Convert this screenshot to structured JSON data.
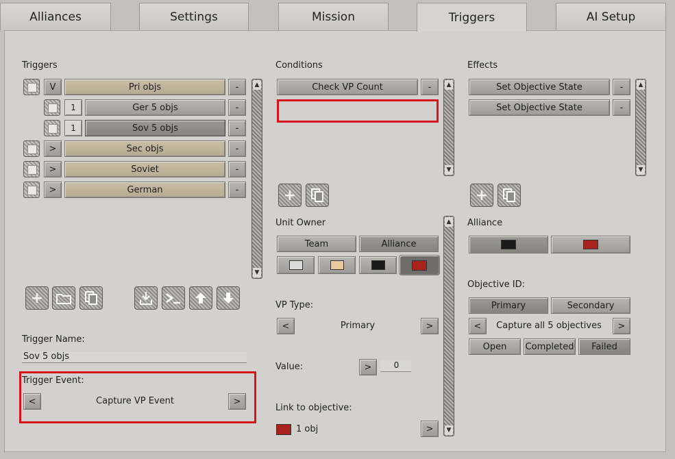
{
  "tabs": [
    "Alliances",
    "Settings",
    "Mission",
    "Triggers",
    "AI Setup"
  ],
  "triggers": {
    "heading": "Triggers",
    "rows": [
      {
        "expand": "V",
        "label": "Pri objs",
        "remove": "-"
      },
      {
        "expand": "1",
        "label": "Ger 5 objs",
        "remove": "-"
      },
      {
        "expand": "1",
        "label": "Sov 5 objs",
        "remove": "-"
      },
      {
        "expand": ">",
        "label": "Sec objs",
        "remove": "-"
      },
      {
        "expand": ">",
        "label": "Soviet",
        "remove": "-"
      },
      {
        "expand": ">",
        "label": "German",
        "remove": "-"
      }
    ],
    "name_label": "Trigger Name:",
    "name_value": "Sov 5 objs",
    "event_label": "Trigger Event:",
    "event_prev": "<",
    "event_value": "Capture VP Event",
    "event_next": ">"
  },
  "conditions": {
    "heading": "Conditions",
    "items": [
      {
        "label": "Check VP Count",
        "remove": "-"
      }
    ],
    "unit_owner_label": "Unit Owner",
    "team_label": "Team",
    "alliance_label": "Alliance",
    "owner_colors": [
      "#dcdcdc",
      "#e9c9a0",
      "#1a1a1a",
      "#a8231c"
    ],
    "vp_type_label": "VP Type:",
    "vp_prev": "<",
    "vp_value": "Primary",
    "vp_next": ">",
    "value_label": "Value:",
    "value_btn": ">",
    "value_value": "0",
    "link_label": "Link to objective:",
    "link_color": "#a8231c",
    "link_value": "1 obj",
    "link_next": ">"
  },
  "effects": {
    "heading": "Effects",
    "items": [
      {
        "label": "Set Objective State",
        "remove": "-"
      },
      {
        "label": "Set Objective State",
        "remove": "-"
      }
    ],
    "alliance_label": "Alliance",
    "alliance_colors": [
      "#1a1a1a",
      "#a8231c"
    ],
    "objective_id_label": "Objective ID:",
    "primary_label": "Primary",
    "secondary_label": "Secondary",
    "obj_prev": "<",
    "obj_value": "Capture all 5 objectives",
    "obj_next": ">",
    "open_label": "Open",
    "completed_label": "Completed",
    "failed_label": "Failed"
  },
  "icons": {
    "add": "+",
    "arrow_up": "▲",
    "arrow_down": "▼"
  }
}
